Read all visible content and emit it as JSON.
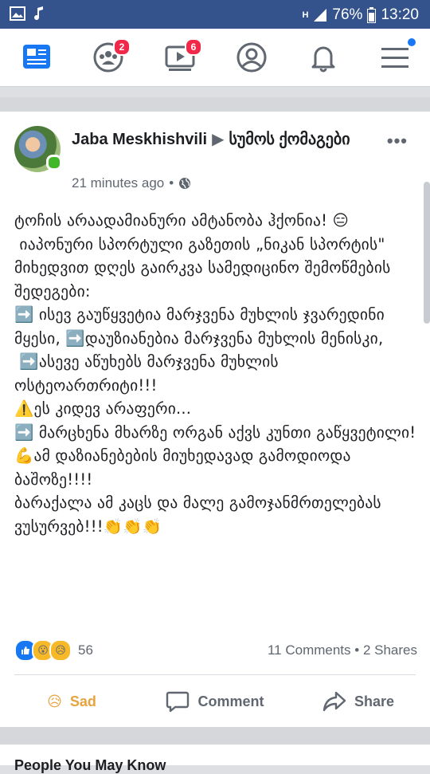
{
  "status_bar": {
    "battery": "76%",
    "time": "13:20",
    "network": "H"
  },
  "nav": {
    "friends_badge": "2",
    "video_badge": "6"
  },
  "post": {
    "author": "Jaba Meskhishvili",
    "group": "სუმოს ქომაგები",
    "time": "21 minutes ago",
    "privacy_icon": "globe-icon",
    "text": "ტოჩის არაადამიანური ამტანობა ჰქონია! 😑\n იაპონური სპორტული გაზეთის „ნიკან სპორტის\" მიხედვით დღეს გაირკვა სამედიცინო შემოწმების შედეგები:\n➡️ ისევ გაუწყვეტია მარჯვენა მუხლის ჯვარედინი მყესი, ➡️დაუზიანებია მარჯვენა მუხლის მენისკი,\n ➡️ასევე აწუხებს მარჯვენა მუხლის ოსტეოართრიტი!!!\n⚠️ეს კიდევ არაფერი...\n➡️ მარცხენა მხარზე ორგან აქვს კუნთი გაწყვეტილი!\n💪ამ დაზიანებების მიუხედავად გამოდიოდა ბაშოზე!!!!\nბარაქალა ამ კაცს და მალე გამოჯანმრთელებას ვუსურვებ!!!👏👏👏",
    "reaction_count": "56",
    "comments": "11 Comments",
    "shares": "2 Shares",
    "actions": {
      "sad": "Sad",
      "comment": "Comment",
      "share": "Share"
    }
  },
  "next_section": {
    "title": "People You May Know"
  },
  "colors": {
    "status_bar": "#34538c",
    "badge": "#f02849",
    "accent": "#1877f2"
  }
}
